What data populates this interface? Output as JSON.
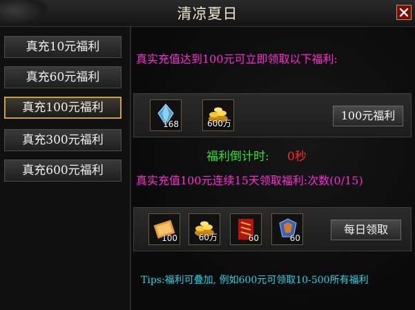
{
  "window": {
    "title": "清凉夏日"
  },
  "sidebar": {
    "items": [
      {
        "label": "真充10元福利"
      },
      {
        "label": "真充60元福利"
      },
      {
        "label": "真充100元福利"
      },
      {
        "label": "真充300元福利"
      },
      {
        "label": "真充600元福利"
      }
    ],
    "active_index": 2
  },
  "main": {
    "headline": "真实充值达到100元可立即领取以下福利:",
    "reward_panel_1": {
      "items": [
        {
          "icon": "blue-crystal-icon",
          "count": "168"
        },
        {
          "icon": "gold-ingot-pile-icon",
          "count": "600万"
        }
      ],
      "button_label": "100元福利"
    },
    "countdown": {
      "label": "福利倒计时:",
      "value": "0秒"
    },
    "daily_headline": "真实充值100元连续15天领取福利:次数(0/15)",
    "reward_panel_2": {
      "items": [
        {
          "icon": "scroll-icon",
          "count": "100"
        },
        {
          "icon": "gold-ingot-pile-icon",
          "count": "60万"
        },
        {
          "icon": "red-talisman-icon",
          "count": "60"
        },
        {
          "icon": "armor-shard-icon",
          "count": "60"
        }
      ],
      "button_label": "每日领取"
    },
    "tips": "Tips:福利可叠加, 例如600元可领取10-500所有福利"
  },
  "colors": {
    "magenta": "#ff2bd6",
    "green": "#2ee62e",
    "red": "#ff2a2a",
    "cyan": "#20d8e8",
    "gold_border": "#c9a24a"
  }
}
